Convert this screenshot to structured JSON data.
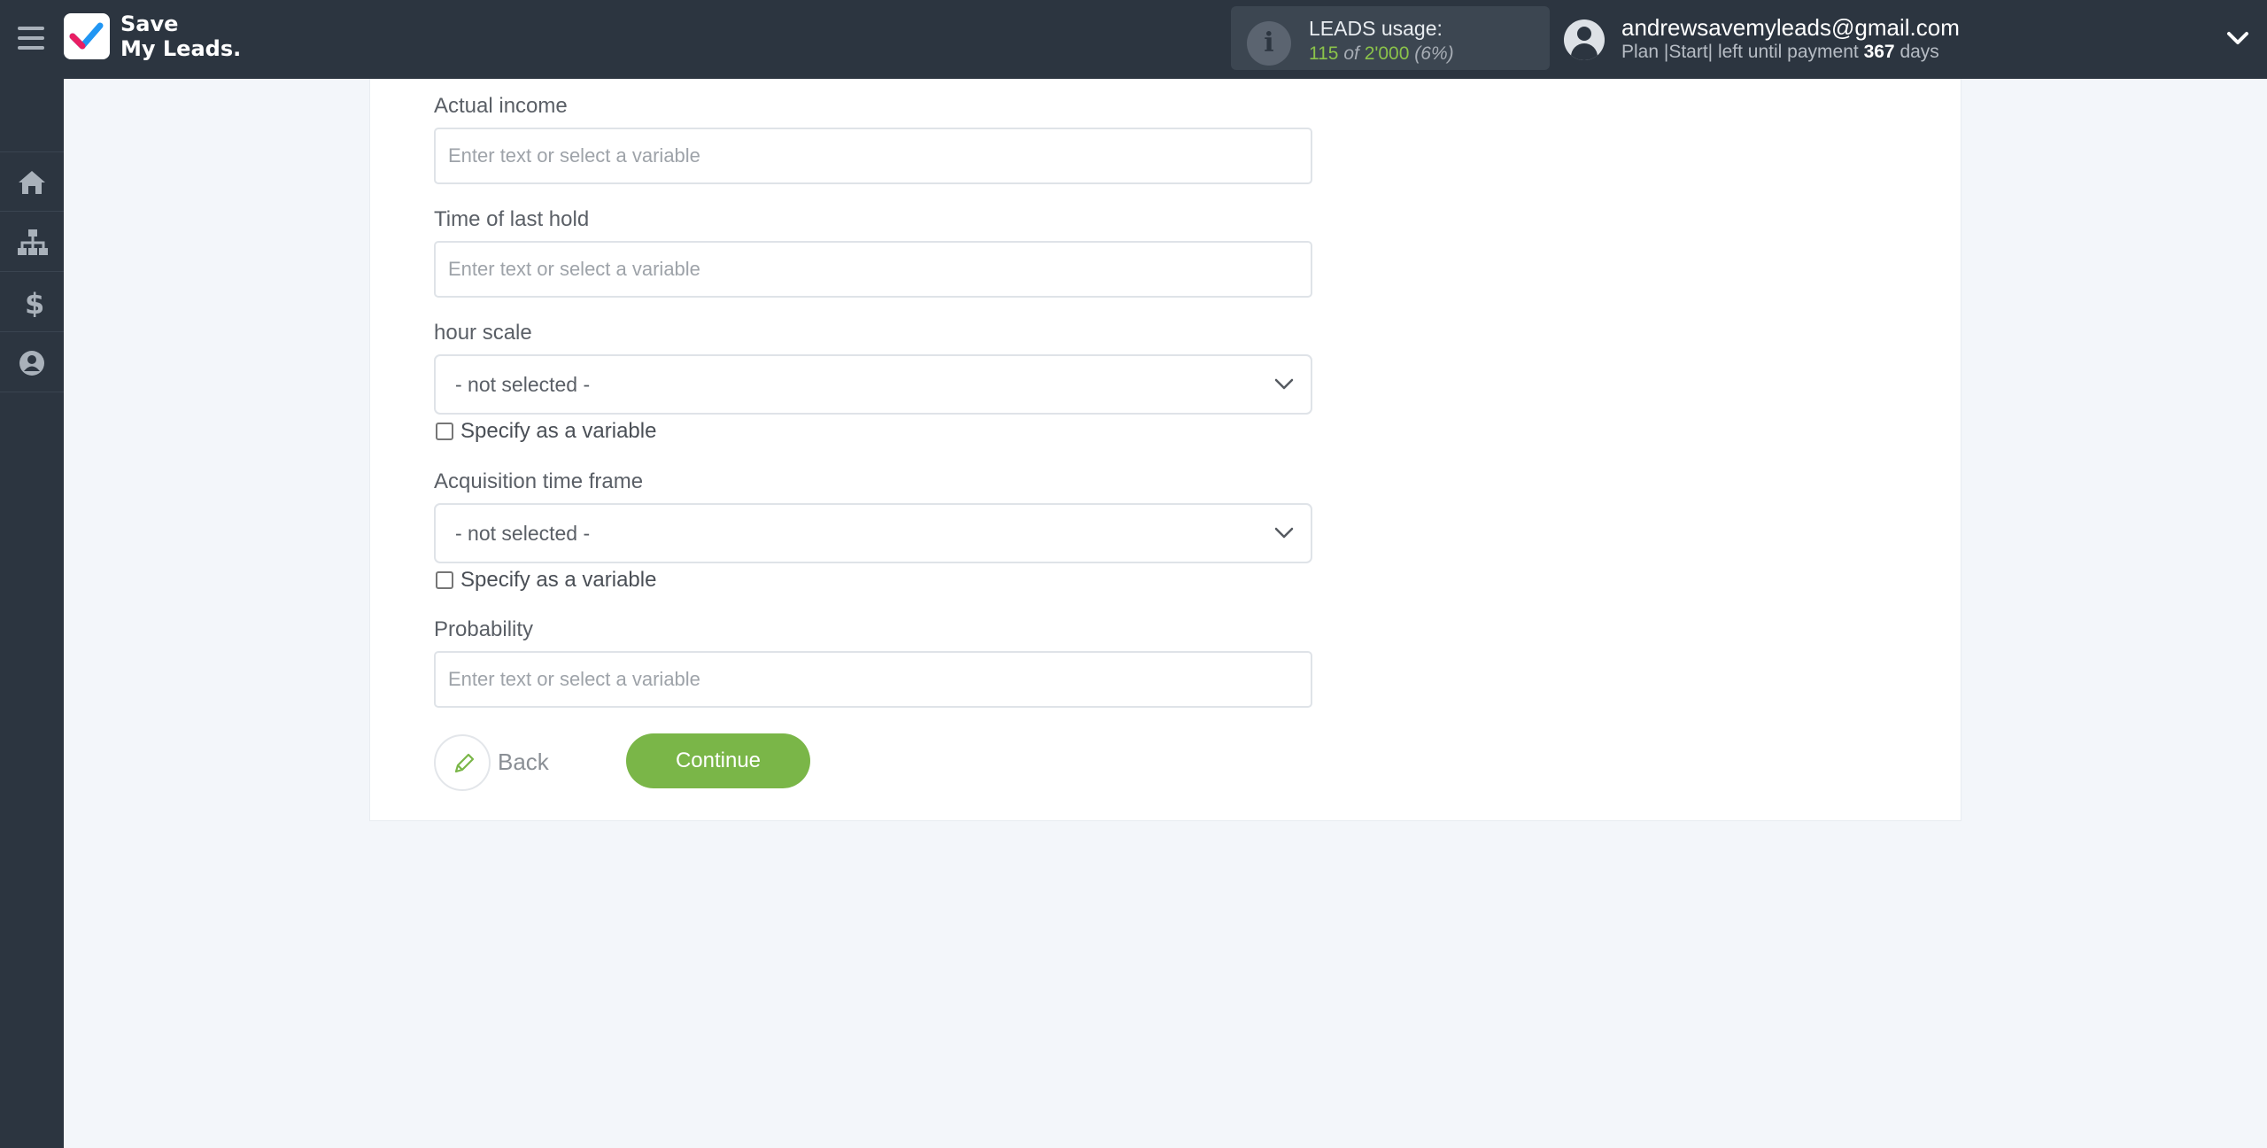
{
  "header": {
    "logo_line1": "Save",
    "logo_line2": "My Leads.",
    "usage_title": "LEADS usage:",
    "usage_used": "115",
    "usage_of": "of",
    "usage_total": "2'000",
    "usage_percent": "(6%)",
    "user_email": "andrewsavemyleads@gmail.com",
    "plan_prefix": "Plan |Start| left until payment",
    "plan_days": "367",
    "plan_suffix": "days"
  },
  "sidebar": {
    "items": [
      {
        "icon": "home-icon"
      },
      {
        "icon": "sitemap-icon"
      },
      {
        "icon": "dollar-icon"
      },
      {
        "icon": "user-circle-icon"
      }
    ]
  },
  "form": {
    "fields": [
      {
        "label": "Actual income",
        "placeholder": "Enter text or select a variable"
      },
      {
        "label": "Time of last hold",
        "placeholder": "Enter text or select a variable"
      },
      {
        "label": "hour scale",
        "value": "- not selected -",
        "checkbox_label": "Specify as a variable"
      },
      {
        "label": "Acquisition time frame",
        "value": "- not selected -",
        "checkbox_label": "Specify as a variable"
      },
      {
        "label": "Probability",
        "placeholder": "Enter text or select a variable"
      }
    ],
    "back_label": "Back",
    "continue_label": "Continue"
  },
  "colors": {
    "topbar": "#2c3540",
    "accent_green": "#7ab648",
    "page_bg": "#f3f6fa"
  }
}
